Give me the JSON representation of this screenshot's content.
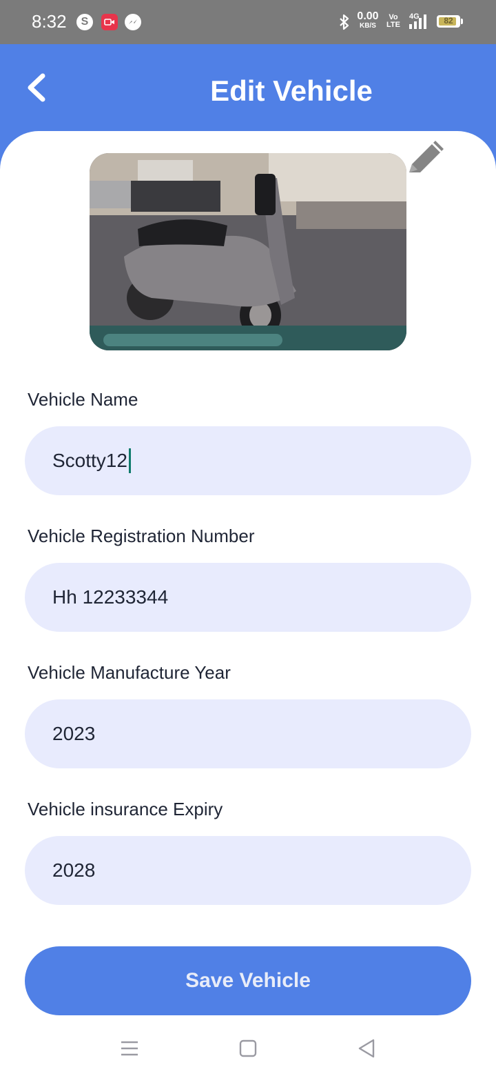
{
  "status_bar": {
    "time": "8:32",
    "net_speed_value": "0.00",
    "net_speed_unit": "KB/S",
    "volte_top": "Vo",
    "volte_bottom": "LTE",
    "network_type": "4G",
    "battery_level": "82",
    "icons": [
      "skype-icon",
      "screen-recorder-icon",
      "messenger-icon",
      "bluetooth-icon",
      "signal-icon",
      "battery-icon"
    ]
  },
  "header": {
    "title": "Edit Vehicle",
    "back_icon": "chevron-left-icon",
    "color": "#5080e6"
  },
  "photo": {
    "edit_icon": "pencil-icon"
  },
  "form": {
    "vehicle_name": {
      "label": "Vehicle Name",
      "value": "Scotty12"
    },
    "registration_number": {
      "label": "Vehicle Registration Number",
      "value": "Hh 12233344"
    },
    "manufacture_year": {
      "label": "Vehicle Manufacture Year",
      "value": "2023"
    },
    "insurance_expiry": {
      "label": "Vehicle insurance Expiry",
      "value": "2028"
    }
  },
  "save_button": {
    "label": "Save Vehicle"
  },
  "nav_bar": {
    "icons": [
      "menu-icon",
      "home-icon",
      "back-icon"
    ]
  },
  "colors": {
    "accent": "#5080e6",
    "input_background": "#e8ebfd",
    "text": "#1f2535",
    "caret": "#0f7a6b"
  }
}
